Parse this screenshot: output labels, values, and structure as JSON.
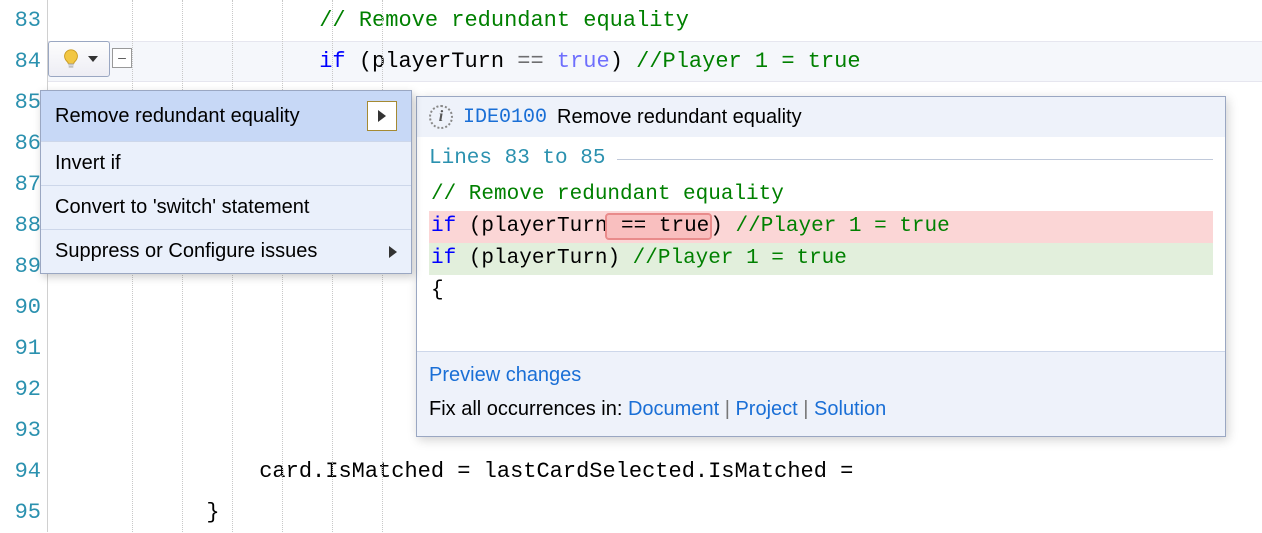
{
  "gutter": {
    "start": 83,
    "end": 95
  },
  "code": {
    "line83_comment": "// Remove redundant equality",
    "line84": {
      "kw_if": "if",
      "open": " (playerTurn ",
      "eq": "== ",
      "kw_true": "true",
      "close": ") ",
      "comment": "//Player 1 = true"
    },
    "line94": "                card.IsMatched = lastCardSelected.IsMatched =",
    "line95": "            }"
  },
  "bulb": {
    "name": "lightbulb-icon"
  },
  "menu": {
    "items": [
      {
        "label": "Remove redundant equality",
        "selected": true,
        "hasSubmenu": true
      },
      {
        "label": "Invert if",
        "selected": false,
        "hasSubmenu": false
      },
      {
        "label": "Convert to 'switch' statement",
        "selected": false,
        "hasSubmenu": false
      },
      {
        "label": "Suppress or Configure issues",
        "selected": false,
        "hasSubmenu": true,
        "plainArrow": true
      }
    ]
  },
  "panel": {
    "ruleId": "IDE0100",
    "ruleTitle": "Remove redundant equality",
    "rangeLabel": "Lines 83 to 85",
    "diff": {
      "commentLine": "// Remove redundant equality",
      "before": {
        "kw_if": "if",
        "pre": " (playerTurn",
        "removed": " == true",
        "post": ") ",
        "comment": "//Player 1 = true"
      },
      "after": {
        "kw_if": "if",
        "body": " (playerTurn) ",
        "comment": "//Player 1 = true"
      },
      "brace": "{"
    },
    "previewLink": "Preview changes",
    "fixAllLabel": "Fix all occurrences in: ",
    "fixTargets": {
      "doc": "Document",
      "proj": "Project",
      "sol": "Solution"
    },
    "sep": " | "
  }
}
